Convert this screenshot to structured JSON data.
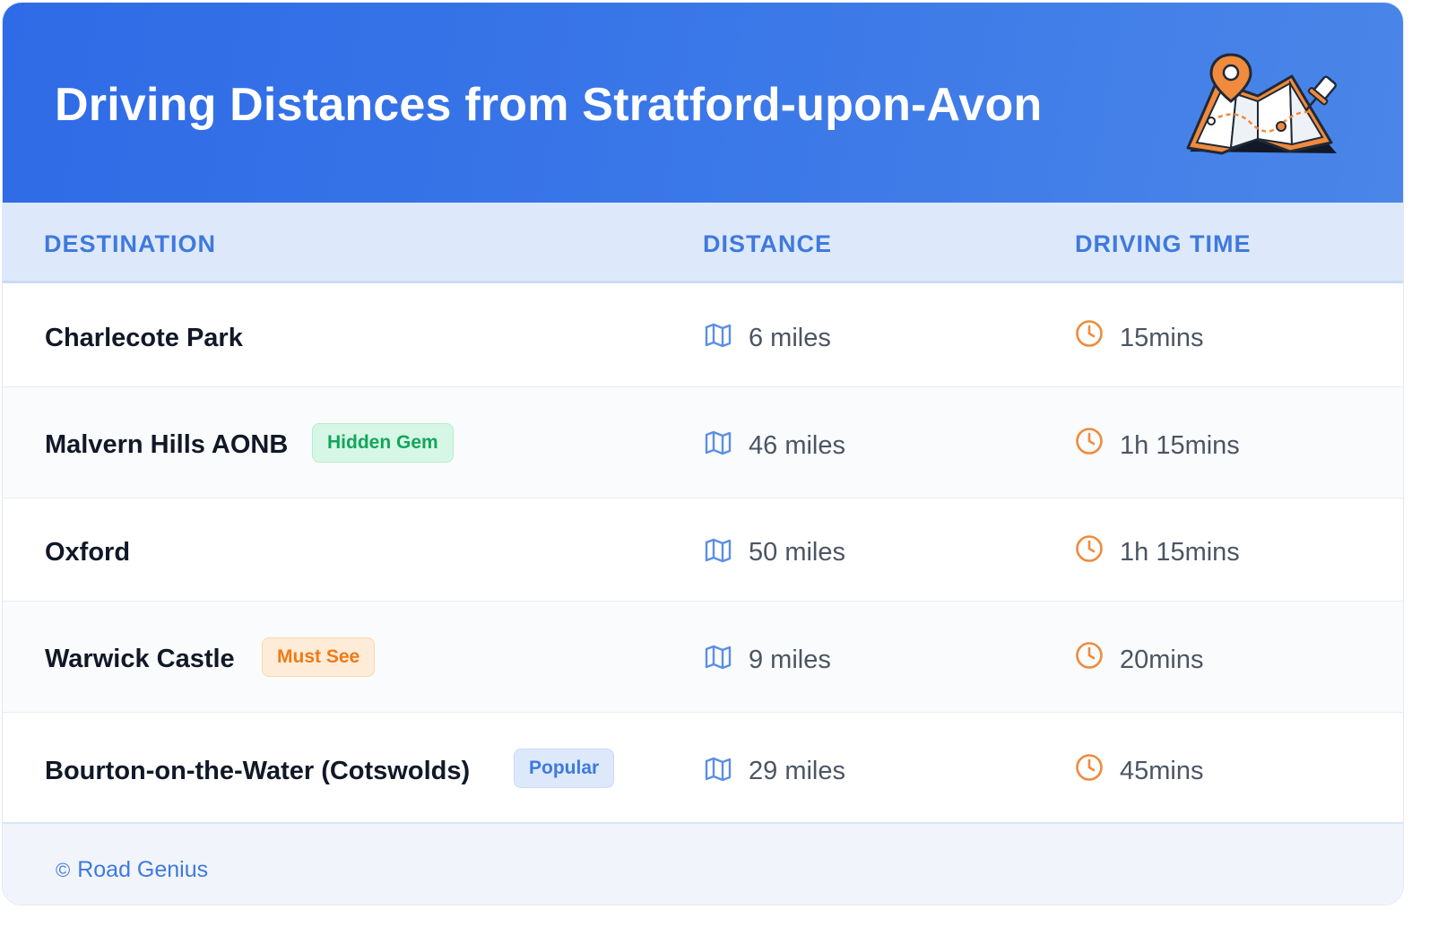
{
  "header": {
    "title": "Driving Distances from Stratford-upon-Avon",
    "illustration_icon": "map-with-pins-icon"
  },
  "colors": {
    "header_gradient_start": "#2f6be6",
    "header_gradient_end": "#4a86e8",
    "accent_blue": "#3f79dd",
    "accent_orange": "#f08a3c",
    "badge_green": "#14a55c",
    "badge_orange": "#ef7a16"
  },
  "table": {
    "columns": [
      "DESTINATION",
      "DISTANCE",
      "DRIVING TIME"
    ],
    "rows": [
      {
        "destination": "Charlecote Park",
        "badge": "",
        "badge_style": "",
        "distance": "6 miles",
        "time": "15mins"
      },
      {
        "destination": "Malvern Hills AONB",
        "badge": "Hidden Gem",
        "badge_style": "green",
        "distance": "46 miles",
        "time": "1h 15mins"
      },
      {
        "destination": "Oxford",
        "badge": "",
        "badge_style": "",
        "distance": "50 miles",
        "time": "1h 15mins"
      },
      {
        "destination": "Warwick Castle",
        "badge": "Must See",
        "badge_style": "orange",
        "distance": "9 miles",
        "time": "20mins"
      },
      {
        "destination": "Bourton-on-the-Water (Cotswolds)",
        "badge": "Popular",
        "badge_style": "blue",
        "distance": "29 miles",
        "time": "45mins"
      }
    ],
    "distance_icon": "map-icon",
    "time_icon": "clock-icon"
  },
  "footer": {
    "copyright_symbol": "©",
    "text": "Road Genius"
  }
}
